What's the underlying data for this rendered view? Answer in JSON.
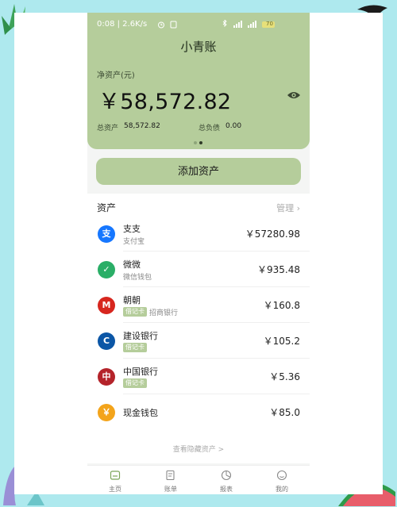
{
  "status_bar": {
    "time_speed": "0:08 | 2.6K/s",
    "battery": "70"
  },
  "app": {
    "title": "小青账"
  },
  "net_worth": {
    "label": "净资产(元)",
    "value": "￥58,572.82",
    "total_assets_label": "总资产",
    "total_assets_value": "58,572.82",
    "total_liabilities_label": "总负债",
    "total_liabilities_value": "0.00"
  },
  "add_asset_label": "添加资产",
  "assets_section": {
    "title": "资产",
    "manage_label": "管理",
    "items": [
      {
        "name": "支支",
        "subtitle": "支付宝",
        "amount": "￥57280.98",
        "icon": "alipay-icon",
        "color": "#1677ff",
        "glyph": "支"
      },
      {
        "name": "微微",
        "subtitle": "微信钱包",
        "amount": "￥935.48",
        "icon": "wechat-icon",
        "color": "#2aae67",
        "glyph": "✓"
      },
      {
        "name": "朝朝",
        "tag": "借记卡",
        "subtitle": "招商银行",
        "amount": "￥160.8",
        "icon": "cmb-bank-icon",
        "color": "#d7261e",
        "glyph": "M"
      },
      {
        "name": "建设银行",
        "tag": "借记卡",
        "amount": "￥105.2",
        "icon": "ccb-bank-icon",
        "color": "#0b56a6",
        "glyph": "C"
      },
      {
        "name": "中国银行",
        "tag": "借记卡",
        "amount": "￥5.36",
        "icon": "boc-bank-icon",
        "color": "#b4232a",
        "glyph": "中"
      },
      {
        "name": "现金钱包",
        "amount": "￥85.0",
        "icon": "cash-icon",
        "color": "#f3a41b",
        "glyph": "￥"
      }
    ],
    "hidden_link": "查看隐藏资产 >"
  },
  "tabs": [
    {
      "label": "主页",
      "icon": "home-icon",
      "active": true
    },
    {
      "label": "账单",
      "icon": "bill-icon",
      "active": false
    },
    {
      "label": "报表",
      "icon": "report-icon",
      "active": false
    },
    {
      "label": "我的",
      "icon": "profile-icon",
      "active": false
    }
  ],
  "colors": {
    "accent": "#b5cd9b",
    "background_outer": "#aee9ee",
    "active_tab": "#7ba55a"
  }
}
